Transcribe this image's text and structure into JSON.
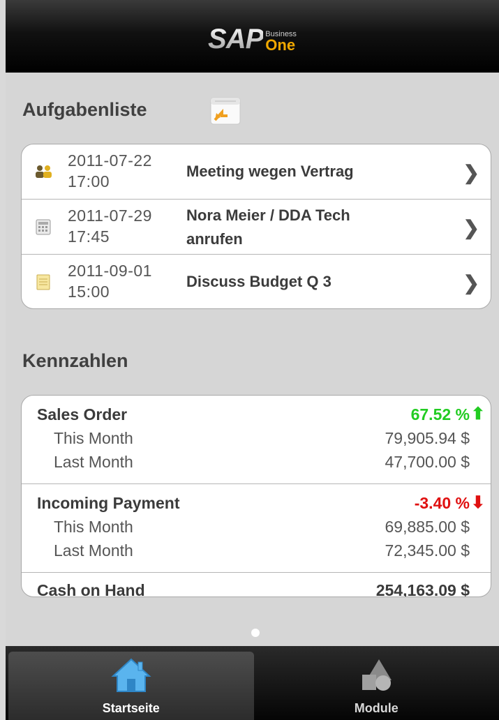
{
  "header": {
    "logo_sap": "SAP",
    "logo_business": "Business",
    "logo_one": "One"
  },
  "tasks": {
    "title": "Aufgabenliste",
    "items": [
      {
        "date": "2011-07-22",
        "time": "17:00",
        "title": "Meeting wegen Vertrag",
        "icon": "meeting-icon"
      },
      {
        "date": "2011-07-29",
        "time": "17:45",
        "title_line1": "Nora Meier / DDA Tech",
        "title_line2": "anrufen",
        "icon": "phone-call-icon"
      },
      {
        "date": "2011-09-01",
        "time": "15:00",
        "title": "Discuss Budget Q 3",
        "icon": "note-icon"
      }
    ]
  },
  "kpis": {
    "title": "Kennzahlen",
    "sales_order": {
      "label": "Sales Order",
      "change": "67.52 %",
      "trend": "up",
      "this_month_label": "This Month",
      "this_month": "79,905.94 $",
      "last_month_label": "Last Month",
      "last_month": "47,700.00 $"
    },
    "incoming_payment": {
      "label": "Incoming Payment",
      "change": "-3.40 %",
      "trend": "down",
      "this_month_label": "This Month",
      "this_month": "69,885.00 $",
      "last_month_label": "Last Month",
      "last_month": "72,345.00 $"
    },
    "cash_on_hand": {
      "label": "Cash on Hand",
      "value": "254,163.09 $"
    }
  },
  "colors": {
    "positive": "#22cc22",
    "negative": "#e01010",
    "brand_one": "#f0a800"
  },
  "tabbar": {
    "tabs": [
      {
        "label": "Startseite",
        "icon": "home-icon",
        "active": true
      },
      {
        "label": "Module",
        "icon": "modules-icon",
        "active": false
      }
    ]
  }
}
